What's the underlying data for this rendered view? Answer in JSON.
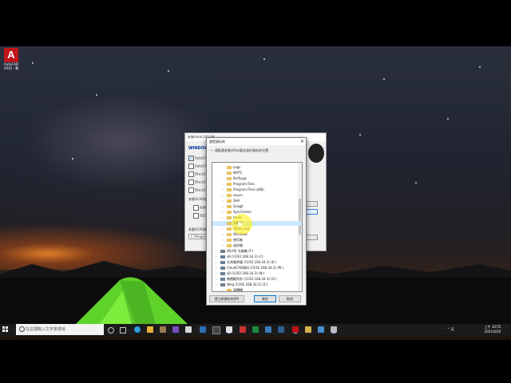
{
  "desktop_icon": {
    "label_line1": "AutoCAD",
    "label_line2": "2010 - 繁"
  },
  "back_window": {
    "title": "安裝AutoCAD元件",
    "heading": "WINDOWS",
    "checkbox_labels": [
      "AutoCAD",
      "AutoCAD",
      "DiscoCAD",
      "DiscoCAD",
      "DiscoCAD"
    ],
    "section_label": "安裝ACAD組",
    "sub_checks": [
      "包含",
      "自訂"
    ],
    "path_label": "多重ACAD路",
    "path_value": "C:\\ProgramFi"
  },
  "dialog": {
    "title": "瀏覽資料夾",
    "prompt": "---- 請點選安裝Ufiles要存放的資料夾位置",
    "tree_items": [
      {
        "label": "Logs",
        "type": "folder",
        "arrow": ""
      },
      {
        "label": "MATS",
        "type": "folder",
        "arrow": ""
      },
      {
        "label": "PerfLogs",
        "type": "folder",
        "arrow": ""
      },
      {
        "label": "Program Files",
        "type": "folder",
        "arrow": "›"
      },
      {
        "label": "Program Files (x86)",
        "type": "folder",
        "arrow": "›"
      },
      {
        "label": "sauce",
        "type": "folder",
        "arrow": "›"
      },
      {
        "label": "SHA",
        "type": "folder",
        "arrow": "›"
      },
      {
        "label": "Snagit",
        "type": "folder",
        "arrow": "›"
      },
      {
        "label": "SyncCenter",
        "type": "folder",
        "arrow": "›"
      },
      {
        "label": "terno",
        "type": "folder",
        "arrow": "›"
      },
      {
        "label": "TEMP",
        "type": "folder",
        "arrow": ""
      },
      {
        "label": "Ufiles_cad",
        "type": "folder",
        "arrow": "›"
      },
      {
        "label": "Windows",
        "type": "folder",
        "arrow": "›"
      },
      {
        "label": "使用者",
        "type": "folder",
        "arrow": "›"
      },
      {
        "label": "迷你碟",
        "type": "folder",
        "arrow": "›"
      },
      {
        "label": "BD-RE 光碟機 (F:)",
        "type": "drive",
        "arrow": "›"
      },
      {
        "label": "sB (\\\\192.168.34.3) (I:)",
        "type": "drive",
        "arrow": "›"
      },
      {
        "label": "台灣業界優 (\\\\192.168.34.3) (K:)",
        "type": "drive",
        "arrow": "›"
      },
      {
        "label": "CloudCAD資料 (\\\\192.168.34.3) (M:)",
        "type": "drive",
        "arrow": "›"
      },
      {
        "label": "sB (\\\\192.168.34.3) (N:)",
        "type": "drive",
        "arrow": "›"
      },
      {
        "label": "婚禮範例系 (\\\\192.168.34.3) (O:)",
        "type": "drive",
        "arrow": "›"
      },
      {
        "label": "dbrg (\\\\192.168.34.3) (Z:)",
        "type": "drive",
        "arrow": "›"
      },
      {
        "label": "媒體櫃",
        "type": "folder",
        "arrow": "›"
      }
    ],
    "selected_index": 10,
    "new_folder_label": "建立新資料夾(M)",
    "ok_label": "確定",
    "cancel_label": "取消"
  },
  "taskbar": {
    "search_placeholder": "在這裡輸入文字來搜尋",
    "tray_text": "^ 英",
    "time": "上午 10:55",
    "date": "2021/4/26"
  }
}
